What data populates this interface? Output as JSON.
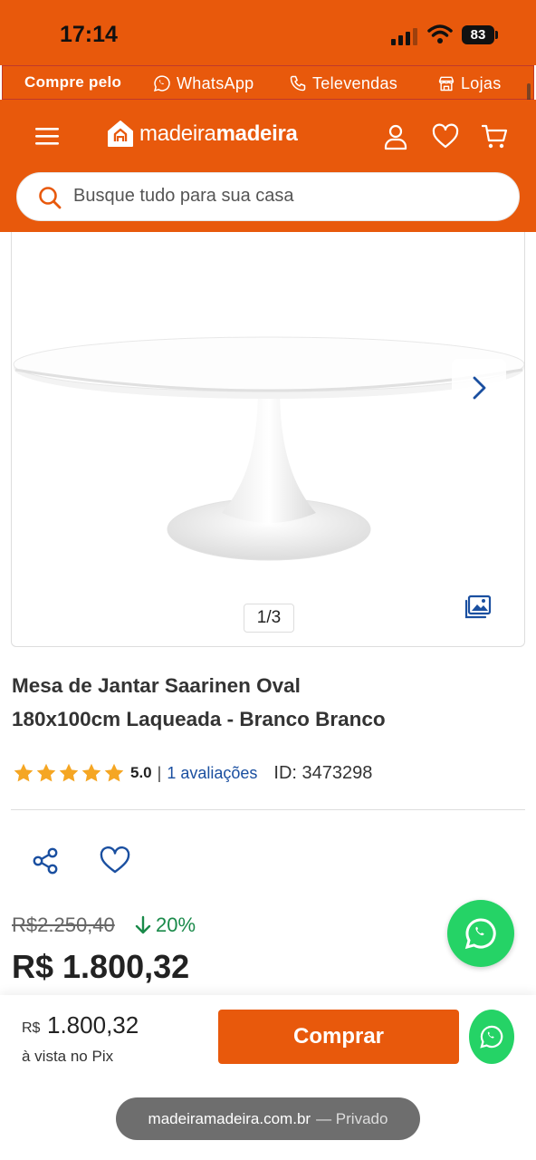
{
  "status_bar": {
    "time": "17:14",
    "battery": "83"
  },
  "promo_bar": {
    "label": "Compre pelo",
    "items": [
      {
        "label": "WhatsApp",
        "icon": "whatsapp-icon"
      },
      {
        "label": "Televendas",
        "icon": "phone-icon"
      },
      {
        "label": "Lojas",
        "icon": "store-icon"
      }
    ]
  },
  "header": {
    "logo_light": "madeira",
    "logo_bold": "madeira",
    "icons": [
      "menu-icon",
      "user-icon",
      "heart-icon",
      "cart-icon"
    ]
  },
  "search": {
    "placeholder": "Busque tudo para sua casa"
  },
  "gallery": {
    "counter": "1/3"
  },
  "product": {
    "title_line1": "Mesa de Jantar Saarinen Oval",
    "title_line2": "180x100cm Laqueada - Branco Branco",
    "rating_value": 5,
    "rating_score": "5.0",
    "separator": "|",
    "reviews": "1 avaliações",
    "id": "ID: 3473298",
    "old_price": "R$2.250,40",
    "discount": "20%",
    "price": "R$ 1.800,32"
  },
  "bottom_bar": {
    "currency": "R$",
    "price": "1.800,32",
    "payment": "à vista no Pix",
    "buy_label": "Comprar"
  },
  "url_bar": {
    "domain": "madeiramadeira.com.br",
    "mode": "— Privado"
  },
  "colors": {
    "brand": "#E8590C",
    "whatsapp": "#25D366",
    "link": "#1A4FA0",
    "discount": "#1A8A4A",
    "star": "#F5A623"
  }
}
